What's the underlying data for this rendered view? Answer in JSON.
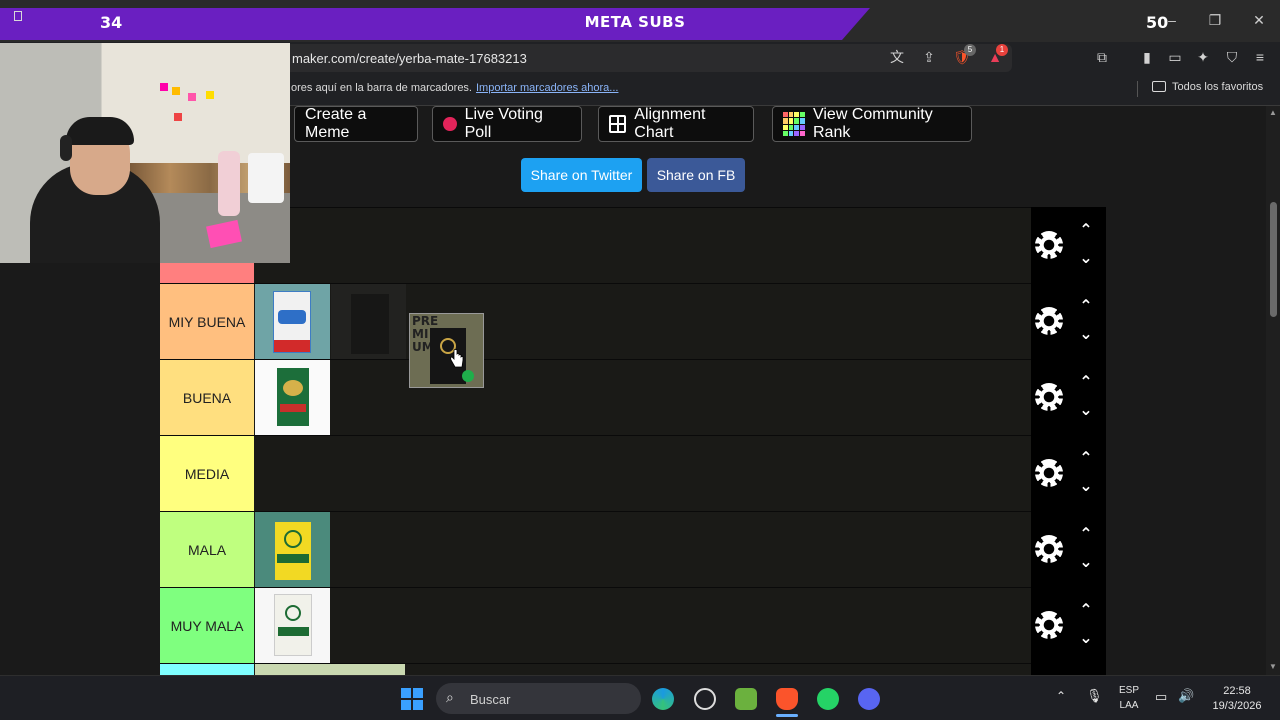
{
  "overlay": {
    "left_count": "34",
    "title": "META SUBS",
    "right_count": "50"
  },
  "browser": {
    "url": "maker.com/create/yerba-mate-17683213",
    "bookmarks_prompt": "ores aquí en la barra de marcadores.",
    "bookmarks_link": "Importar marcadores ahora...",
    "favorites_label": "Todos los favoritos",
    "shield_badge": "5",
    "alert_badge": "1"
  },
  "toolbar": {
    "create_meme": "Create a Meme",
    "live_voting": "Live Voting Poll",
    "alignment_chart": "Alignment Chart",
    "community_rank": "View Community Rank"
  },
  "share": {
    "twitter": "Share on Twitter",
    "fb": "Share on FB"
  },
  "tiers": [
    {
      "label": "",
      "color": "#ff7f7f"
    },
    {
      "label": "MIY BUENA",
      "color": "#ffbf7f"
    },
    {
      "label": "BUENA",
      "color": "#ffdf7f"
    },
    {
      "label": "MEDIA",
      "color": "#ffff7f"
    },
    {
      "label": "MALA",
      "color": "#bfff7f"
    },
    {
      "label": "MUY MALA",
      "color": "#7fff7f"
    }
  ],
  "items": {
    "premium_text": "PRE MI UM"
  },
  "taskbar": {
    "search_placeholder": "Buscar",
    "lang_top": "ESP",
    "lang_bottom": "LAA",
    "time": "22:58",
    "date": "19/3/2026"
  },
  "colors": {
    "overlay_purple": "#6a1fc1",
    "twitter_blue": "#1da1f2",
    "fb_blue": "#3b5998",
    "voting_dot": "#e2245a"
  }
}
